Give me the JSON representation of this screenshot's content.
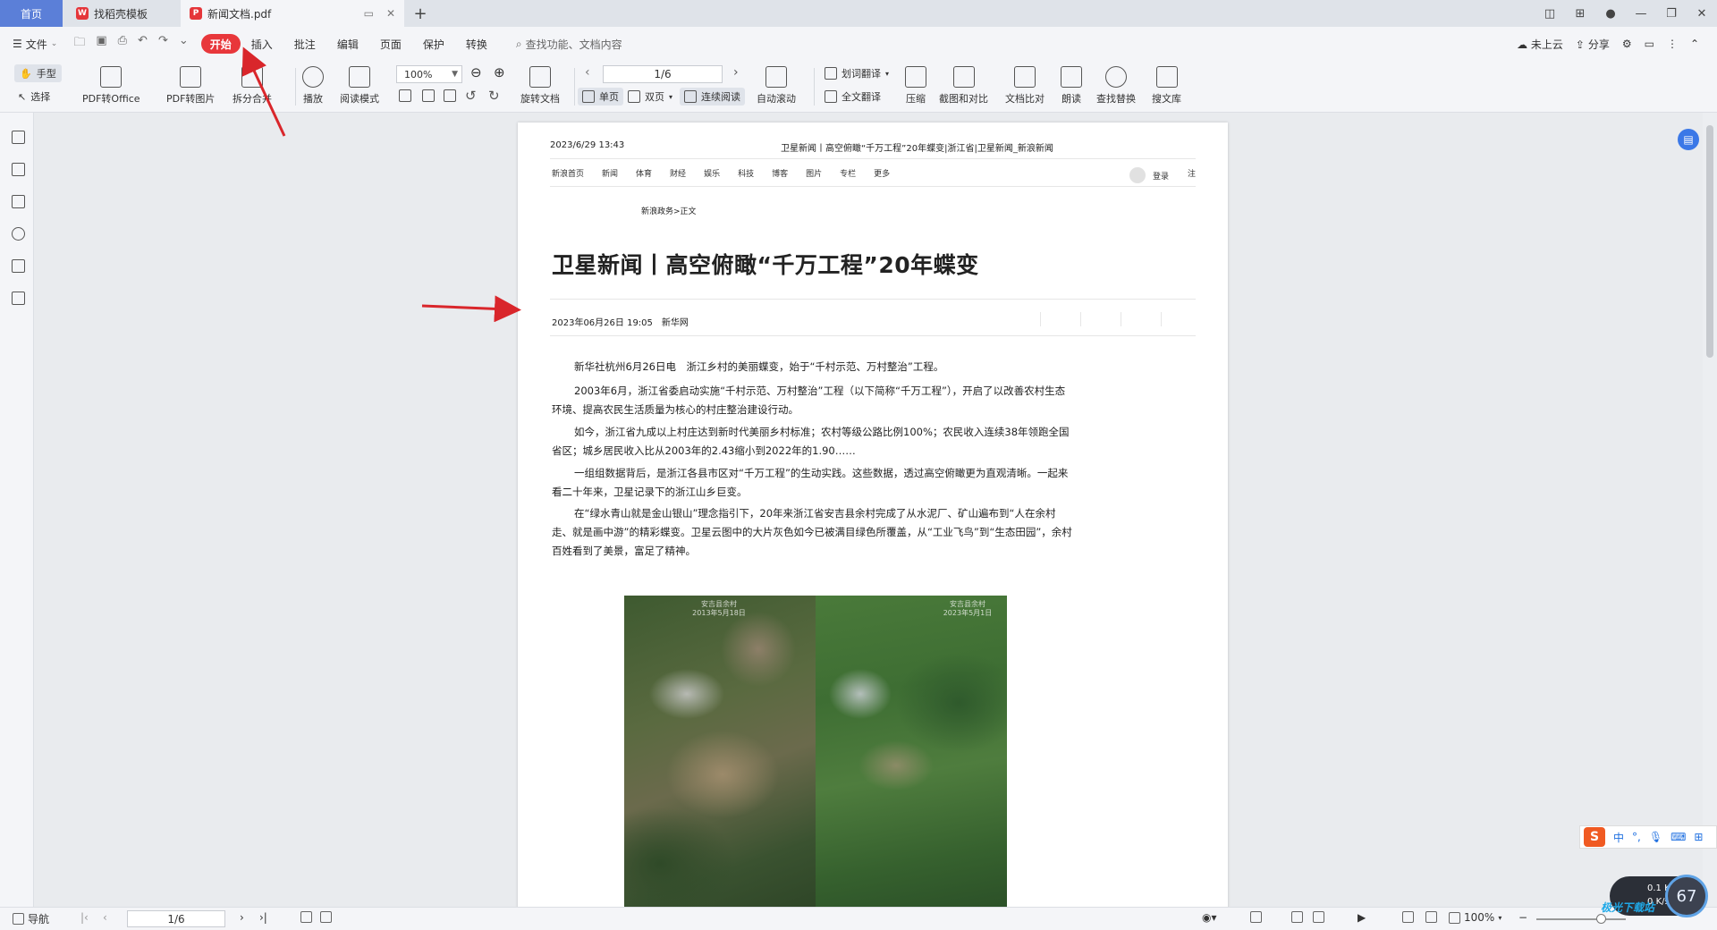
{
  "tabs": {
    "home": "首页",
    "templates": "找稻壳模板",
    "doc": "新闻文档.pdf",
    "new_tab": "+"
  },
  "menubar": {
    "file": "文件",
    "tabs": [
      "开始",
      "插入",
      "批注",
      "编辑",
      "页面",
      "保护",
      "转换"
    ],
    "search": "查找功能、文档内容",
    "cloud": "未上云",
    "share": "分享"
  },
  "ribbon": {
    "hand": "手型",
    "select": "选择",
    "pdf_to_office": "PDF转Office",
    "pdf_to_image": "PDF转图片",
    "split_merge": "拆分合并",
    "play": "播放",
    "read_mode": "阅读模式",
    "zoom": "100%",
    "rotate": "旋转文档",
    "page": "1/6",
    "single": "单页",
    "double": "双页",
    "continuous": "连续阅读",
    "auto_scroll": "自动滚动",
    "word_translate": "划词翻译",
    "full_translate": "全文翻译",
    "compress": "压缩",
    "screenshot_compare": "截图和对比",
    "doc_compare": "文档比对",
    "read_aloud": "朗读",
    "find_replace": "查找替换",
    "search_lib": "搜文库"
  },
  "document": {
    "header_date": "2023/6/29 13:43",
    "header_title": "卫星新闻丨高空俯瞰“千万工程”20年蝶变|浙江省|卫星新闻_新浪新闻",
    "nav": [
      "新浪首页",
      "新闻",
      "体育",
      "财经",
      "娱乐",
      "科技",
      "博客",
      "图片",
      "专栏",
      "更多"
    ],
    "login": "登录",
    "register": "注",
    "breadcrumb": "新浪政务>正文",
    "headline": "卫星新闻丨高空俯瞰“千万工程”20年蝶变",
    "meta_time": "2023年06月26日 19:05",
    "meta_source": "新华网",
    "paragraphs": [
      "新华社杭州6月26日电　浙江乡村的美丽蝶变，始于“千村示范、万村整治”工程。",
      "2003年6月，浙江省委启动实施“千村示范、万村整治”工程（以下简称“千万工程”），开启了以改善农村生态环境、提高农民生活质量为核心的村庄整治建设行动。",
      "如今，浙江省九成以上村庄达到新时代美丽乡村标准；农村等级公路比例100%；农民收入连续38年领跑全国省区；城乡居民收入比从2003年的2.43缩小到2022年的1.90……",
      "一组组数据背后，是浙江各县市区对“千万工程”的生动实践。这些数据，透过高空俯瞰更为直观清晰。一起来看二十年来，卫星记录下的浙江山乡巨变。",
      "在“绿水青山就是金山银山”理念指引下，20年来浙江省安吉县余村完成了从水泥厂、矿山遍布到“人在余村走、就是画中游”的精彩蝶变。卫星云图中的大片灰色如今已被满目绿色所覆盖，从“工业飞鸟”到“生态田园”，余村百姓看到了美景，富足了精神。"
    ],
    "image_caption_left": "安吉县余村\n2013年5月18日",
    "image_caption_right": "安吉县余村\n2023年5月1日"
  },
  "statusbar": {
    "nav": "导航",
    "page": "1/6",
    "zoom": "100%"
  },
  "overlay": {
    "ime_lang": "中",
    "net_up": "0.1",
    "net_down": "0",
    "net_unit": "K/s",
    "gauge": "67",
    "watermark": "极光下载站"
  }
}
